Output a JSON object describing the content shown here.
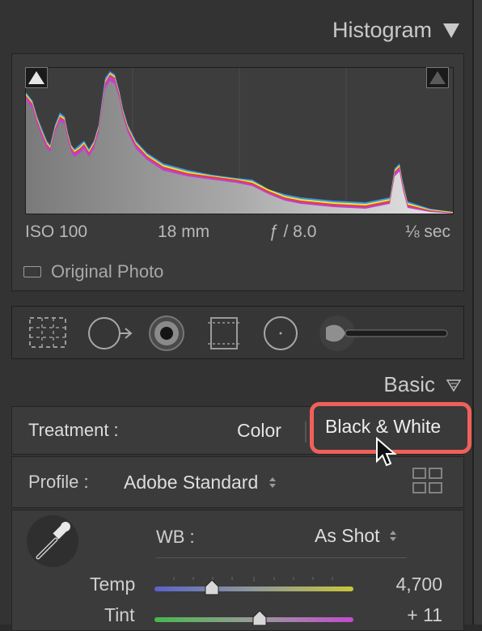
{
  "histogram": {
    "title": "Histogram",
    "exif": {
      "iso": "ISO 100",
      "focal_length": "18 mm",
      "aperture": "ƒ / 8.0",
      "shutter": "⅛ sec"
    },
    "original_photo_label": "Original Photo",
    "original_photo_checked": false
  },
  "basic": {
    "title": "Basic",
    "treatment": {
      "label": "Treatment :",
      "color_label": "Color",
      "bw_label": "Black & White",
      "selected": "Black & White",
      "highlight_color": "#f0605a"
    },
    "profile": {
      "label": "Profile :",
      "value": "Adobe Standard"
    },
    "wb": {
      "label": "WB :",
      "value": "As Shot"
    },
    "sliders": [
      {
        "label": "Temp",
        "value": "4,700",
        "position": 0.29
      },
      {
        "label": "Tint",
        "value": "+ 11",
        "position": 0.53
      }
    ]
  },
  "tools": [
    "crop-overlay-icon",
    "spot-removal-icon",
    "red-eye-icon",
    "graduated-filter-icon",
    "radial-filter-icon",
    "adjustment-brush-icon"
  ]
}
